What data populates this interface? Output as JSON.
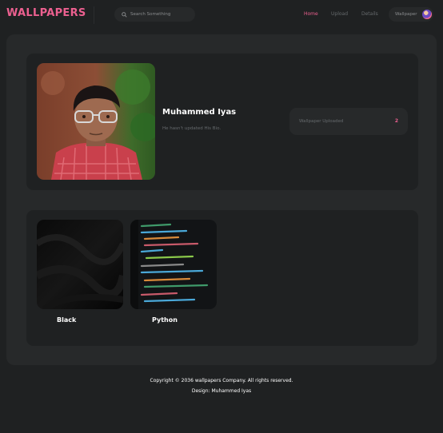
{
  "header": {
    "logo": "WALLPAPERS",
    "search_placeholder": "Search Something",
    "nav": [
      {
        "label": "Home",
        "active": true
      },
      {
        "label": "Upload",
        "active": false
      },
      {
        "label": "Details",
        "active": false
      }
    ],
    "profile_label": "Wallpaper"
  },
  "profile": {
    "name": "Muhammed Iyas",
    "bio": "He hasn't updated His Bio.",
    "stat_label": "Wallpaper Uploaded",
    "stat_value": "2"
  },
  "wallpapers": [
    {
      "title": "Black"
    },
    {
      "title": "Python"
    }
  ],
  "footer": {
    "copyright": "Copyright © 2036 wallpapers Company. All rights reserved.",
    "design": "Design: Muhammed Iyas"
  },
  "colors": {
    "accent": "#ec6090",
    "background": "#1f2122",
    "panel": "#27292a"
  },
  "icons": {
    "search": "search-icon",
    "avatar": "user-avatar"
  }
}
